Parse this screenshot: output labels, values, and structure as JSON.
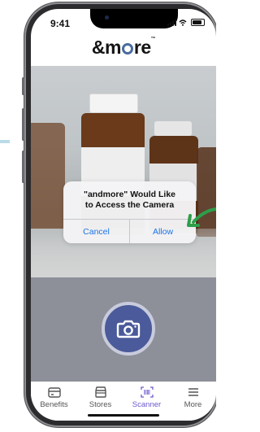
{
  "status_bar": {
    "time": "9:41"
  },
  "app": {
    "logo_text_pre": "&m",
    "logo_text_post": "re",
    "logo_tm": "™"
  },
  "dialog": {
    "title_line1": "\"andmore\" Would Like",
    "title_line2": "to Access the Camera",
    "cancel_label": "Cancel",
    "allow_label": "Allow"
  },
  "tabs": [
    {
      "label": "Benefits",
      "icon": "wallet-icon",
      "active": false
    },
    {
      "label": "Stores",
      "icon": "store-icon",
      "active": false
    },
    {
      "label": "Scanner",
      "icon": "barcode-scanner-icon",
      "active": true
    },
    {
      "label": "More",
      "icon": "menu-icon",
      "active": false
    }
  ],
  "colors": {
    "accent": "#4a5a9a",
    "active_tab": "#6a5acd",
    "dialog_button": "#1a73e8",
    "arrow": "#2e9e4a"
  }
}
